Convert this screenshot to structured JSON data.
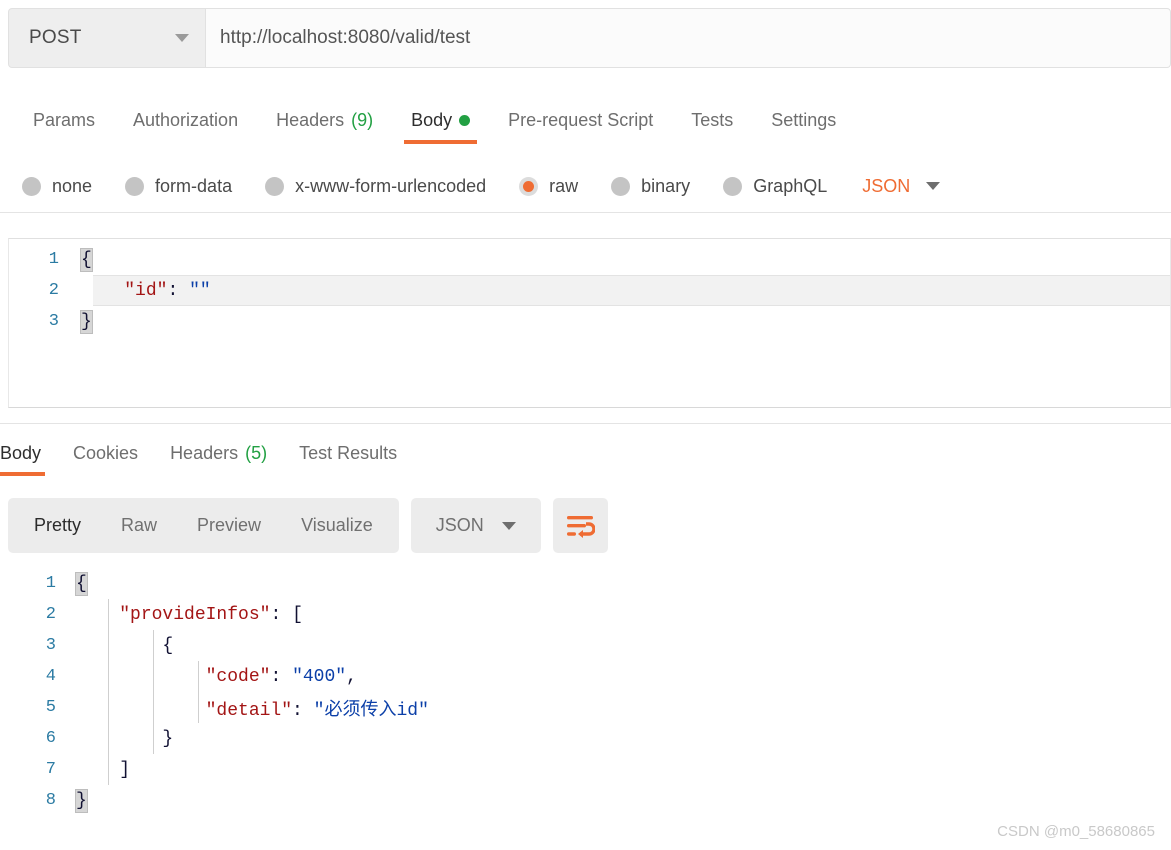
{
  "request": {
    "method": "POST",
    "method_icon": "chevron-down-icon",
    "url": "http://localhost:8080/valid/test",
    "url_placeholder": "Enter request URL",
    "tabs": [
      {
        "label": "Params",
        "count": "",
        "active": false,
        "dot": false
      },
      {
        "label": "Authorization",
        "count": "",
        "active": false,
        "dot": false
      },
      {
        "label": "Headers",
        "count": "(9)",
        "active": false,
        "dot": false
      },
      {
        "label": "Body",
        "count": "",
        "active": true,
        "dot": true
      },
      {
        "label": "Pre-request Script",
        "count": "",
        "active": false,
        "dot": false
      },
      {
        "label": "Tests",
        "count": "",
        "active": false,
        "dot": false
      },
      {
        "label": "Settings",
        "count": "",
        "active": false,
        "dot": false
      }
    ],
    "body_types": [
      {
        "label": "none",
        "selected": false
      },
      {
        "label": "form-data",
        "selected": false
      },
      {
        "label": "x-www-form-urlencoded",
        "selected": false
      },
      {
        "label": "raw",
        "selected": true
      },
      {
        "label": "binary",
        "selected": false
      },
      {
        "label": "GraphQL",
        "selected": false
      }
    ],
    "raw_format": "JSON",
    "raw_format_icon": "chevron-down-icon",
    "editor_lines": [
      {
        "num": "1",
        "text": "{"
      },
      {
        "num": "2",
        "text": "    \"id\": \"\""
      },
      {
        "num": "3",
        "text": "}"
      }
    ]
  },
  "response": {
    "tabs": [
      {
        "label": "Body",
        "count": "",
        "active": true
      },
      {
        "label": "Cookies",
        "count": "",
        "active": false
      },
      {
        "label": "Headers",
        "count": "(5)",
        "active": false
      },
      {
        "label": "Test Results",
        "count": "",
        "active": false
      }
    ],
    "view_modes": [
      {
        "label": "Pretty",
        "active": true
      },
      {
        "label": "Raw",
        "active": false
      },
      {
        "label": "Preview",
        "active": false
      },
      {
        "label": "Visualize",
        "active": false
      }
    ],
    "format": "JSON",
    "format_icon": "chevron-down-icon",
    "wrap_icon": "word-wrap-icon",
    "body_lines": [
      {
        "num": "1",
        "text": "{"
      },
      {
        "num": "2",
        "text": "    \"provideInfos\": ["
      },
      {
        "num": "3",
        "text": "        {"
      },
      {
        "num": "4",
        "text": "            \"code\": \"400\","
      },
      {
        "num": "5",
        "text": "            \"detail\": \"必须传入id\""
      },
      {
        "num": "6",
        "text": "        }"
      },
      {
        "num": "7",
        "text": "    ]"
      },
      {
        "num": "8",
        "text": "}"
      }
    ]
  },
  "watermark": "CSDN @m0_58680865",
  "colors": {
    "accent": "#ef6c33",
    "success": "#22a043",
    "json_key": "#a31515",
    "json_string": "#0b3fa8",
    "gutter": "#2b7ba3"
  }
}
